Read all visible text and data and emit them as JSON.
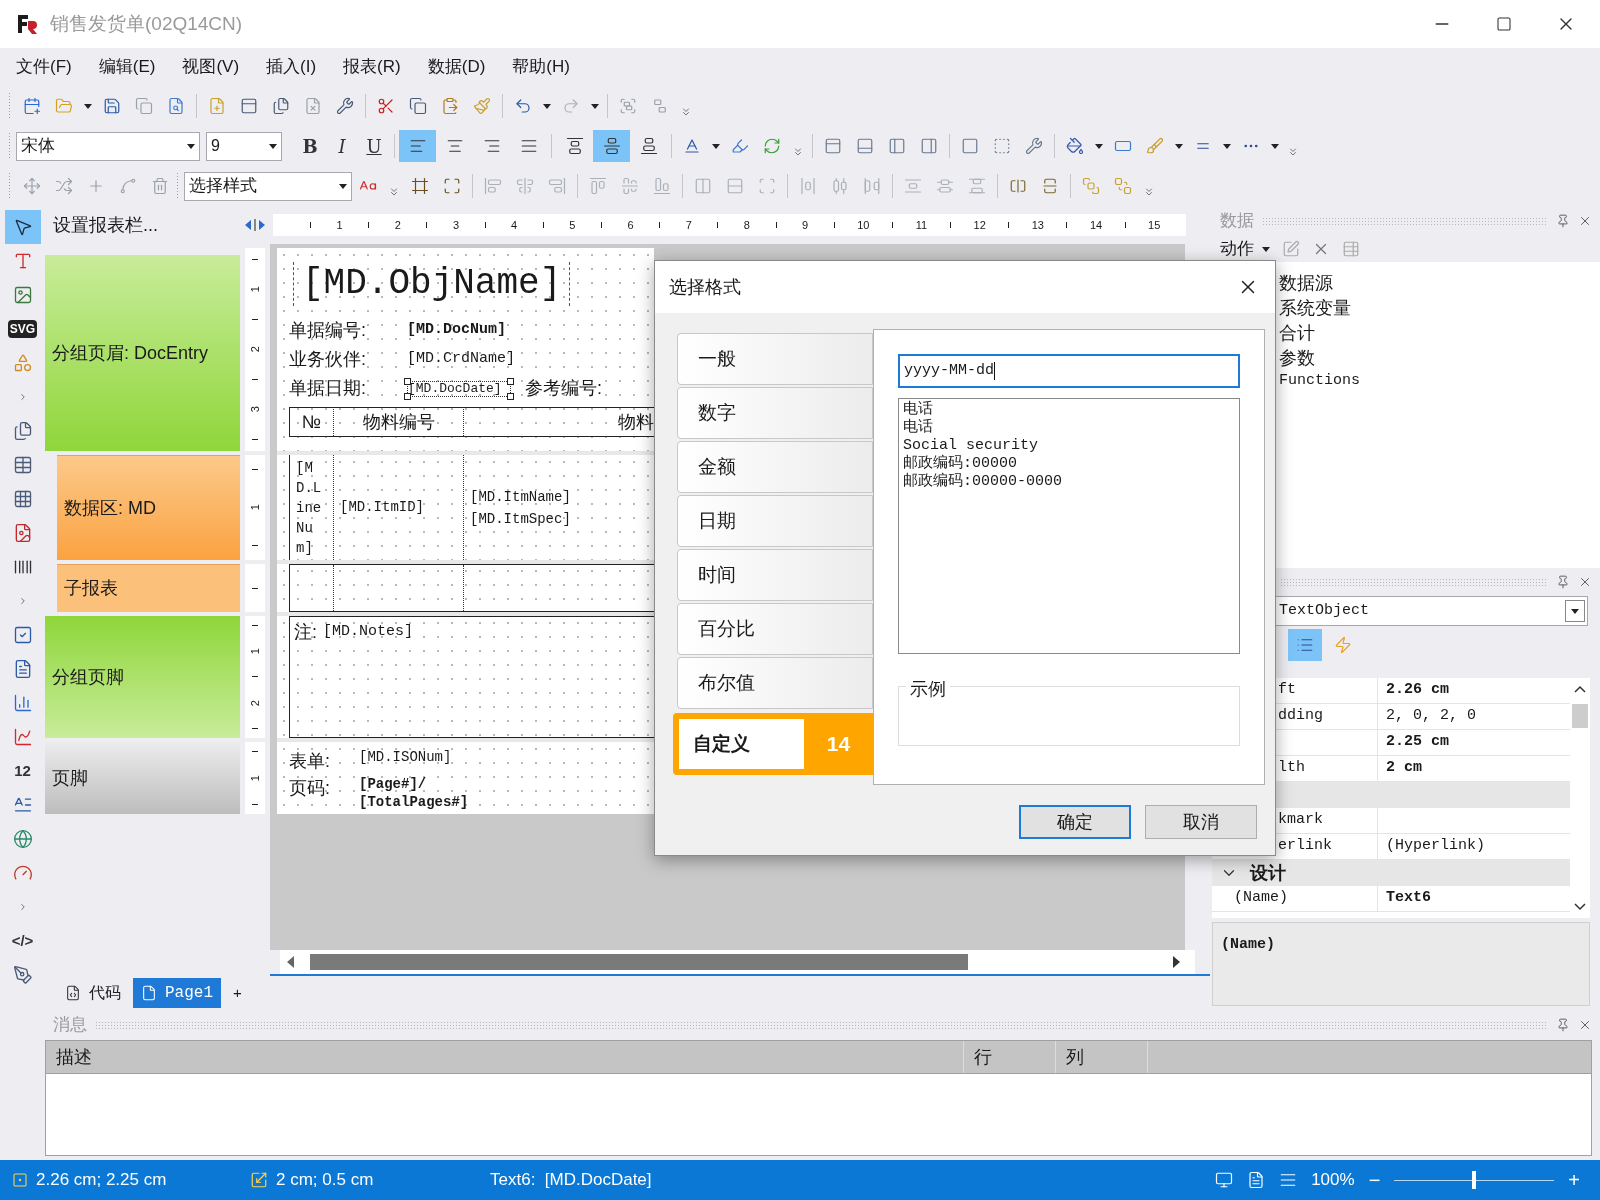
{
  "window": {
    "title": "销售发货单(02Q14CN)"
  },
  "menu": [
    "文件(F)",
    "编辑(E)",
    "视图(V)",
    "插入(I)",
    "报表(R)",
    "数据(D)",
    "帮助(H)"
  ],
  "toolbar": {
    "font": "宋体",
    "font_size": "9",
    "bold": "B",
    "italic": "I",
    "underline": "U",
    "style": "选择样式",
    "horizontal_align": [
      {
        "selected": true
      },
      {
        "selected": false
      },
      {
        "selected": false
      },
      {
        "selected": false
      }
    ],
    "vertical_align": [
      {
        "selected": false
      },
      {
        "selected": true
      },
      {
        "selected": false
      }
    ]
  },
  "tools": [
    {
      "selected": true
    },
    {
      "selected": false
    },
    {
      "selected": false
    },
    {
      "selected": false,
      "label": "SVG"
    },
    {
      "selected": false
    },
    {
      "selected": false
    },
    {
      "selected": false
    },
    {
      "selected": false
    },
    {
      "selected": false
    },
    {
      "selected": false
    },
    {
      "selected": false
    },
    {
      "selected": false
    },
    {
      "selected": false
    },
    {
      "selected": false
    },
    {
      "selected": false
    },
    {
      "selected": false
    },
    {
      "selected": false,
      "label": "12"
    },
    {
      "selected": false
    },
    {
      "selected": false
    },
    {
      "selected": false
    },
    {
      "selected": false
    },
    {
      "selected": false,
      "label": "</>"
    },
    {
      "selected": false
    }
  ],
  "band_panel": {
    "title": "设置报表栏...",
    "bands": [
      {
        "kind": "group_header",
        "label": "分组页眉: DocEntry",
        "ruler": [
          "1",
          "2",
          "3"
        ]
      },
      {
        "kind": "data",
        "label": "数据区: MD",
        "ruler": [
          "1"
        ]
      },
      {
        "kind": "subreport",
        "label": "子报表"
      },
      {
        "kind": "group_footer",
        "label": "分组页脚",
        "ruler": [
          "1",
          "2"
        ]
      },
      {
        "kind": "page_footer",
        "label": "页脚",
        "ruler": [
          "1"
        ]
      }
    ]
  },
  "ruler": [
    "1",
    "2",
    "3",
    "4",
    "5",
    "6",
    "7",
    "8",
    "9",
    "10",
    "11",
    "12",
    "13",
    "14",
    "15"
  ],
  "report": {
    "title": "[MD.ObjName]",
    "fields": [
      {
        "label": "单据编号:",
        "value": "[MD.DocNum]",
        "bold": true,
        "selected": false
      },
      {
        "label": "业务伙伴:",
        "value": "[MD.CrdName]",
        "bold": false,
        "selected": false
      },
      {
        "label": "单据日期:",
        "value": "[MD.DocDate]",
        "bold": false,
        "selected": true
      }
    ],
    "ref_label": "参考编号:",
    "table_header": [
      "№",
      "物料编号",
      "物料"
    ],
    "line_num": "[MD.LineNum]",
    "item_id": "[MD.ItmID]",
    "item_lines": [
      "[MD.ItmName]",
      "[MD.ItmSpec]"
    ],
    "notes_label": "注:",
    "notes_value": "[MD.Notes]",
    "footer": [
      {
        "label": "表单:",
        "lines": [
          "[MD.ISONum]"
        ],
        "bold": false
      },
      {
        "label": "页码:",
        "lines": [
          "[Page#]/",
          "[TotalPages#]"
        ],
        "bold": true
      }
    ]
  },
  "page_tabs": [
    {
      "label": "代码",
      "selected": false
    },
    {
      "label": "Page1",
      "selected": true
    }
  ],
  "add_tab": "+",
  "data_panel": {
    "title": "数据",
    "action": "动作",
    "items": [
      "数据源",
      "系统变量",
      "合计",
      "参数",
      "Functions"
    ]
  },
  "properties": {
    "object": "TextObject",
    "tabs": [
      {
        "selected": true
      },
      {
        "selected": false
      }
    ],
    "rows": [
      {
        "kind": "prop",
        "name": "ft",
        "value": "2.26 cm",
        "bold": true
      },
      {
        "kind": "prop",
        "name": "dding",
        "value": "2, 0, 2, 0",
        "bold": false
      },
      {
        "kind": "prop",
        "value": "2.25 cm",
        "bold": true
      },
      {
        "kind": "prop",
        "name": "lth",
        "value": "2 cm",
        "bold": true
      },
      {
        "kind": "category"
      },
      {
        "kind": "prop",
        "name": "kmark"
      },
      {
        "kind": "prop",
        "name": "erlink",
        "value": "(Hyperlink)",
        "bold": false
      },
      {
        "kind": "category",
        "label": "设计",
        "expanded": true
      },
      {
        "kind": "prop",
        "name": "(Name)",
        "value": "Text6",
        "bold": true
      }
    ],
    "description": "(Name)"
  },
  "messages": {
    "title": "消息",
    "columns": [
      "描述",
      "行",
      "列"
    ]
  },
  "dialog": {
    "title": "选择格式",
    "categories": [
      {
        "label": "一般",
        "selected": false
      },
      {
        "label": "数字",
        "selected": false
      },
      {
        "label": "金额",
        "selected": false
      },
      {
        "label": "日期",
        "selected": false
      },
      {
        "label": "时间",
        "selected": false
      },
      {
        "label": "百分比",
        "selected": false
      },
      {
        "label": "布尔值",
        "selected": false
      },
      {
        "label": "自定义",
        "selected": true,
        "badge": "14"
      }
    ],
    "format": "yyyy-MM-dd",
    "formats": [
      "电话",
      "电话",
      "Social security",
      "邮政编码:00000",
      "邮政编码:00000-0000"
    ],
    "sample_label": "示例",
    "ok": "确定",
    "cancel": "取消"
  },
  "status_bar": {
    "position": "2.26 cm; 2.25 cm",
    "size": "2 cm; 0.5 cm",
    "object": "Text6:  [MD.DocDate]",
    "zoom": "100%",
    "zoom_out": "−",
    "zoom_in": "+",
    "zoom_slider": {
      "level": 0.5
    }
  }
}
